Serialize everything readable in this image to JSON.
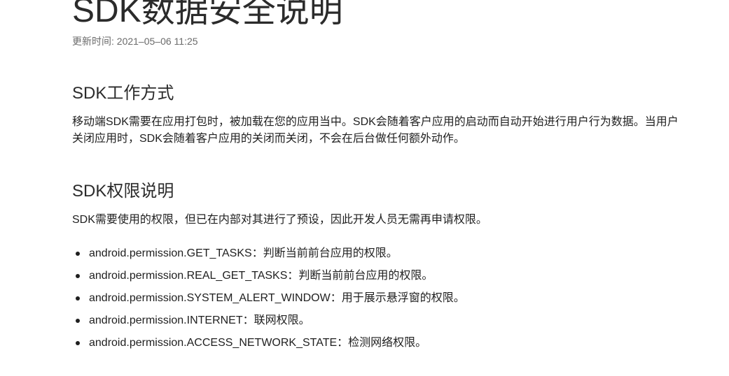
{
  "page": {
    "title": "SDK数据安全说明",
    "update_time": "更新时间: 2021–05–06 11:25"
  },
  "sections": [
    {
      "heading": "SDK工作方式",
      "paragraph": "移动端SDK需要在应用打包时，被加载在您的应用当中。SDK会随着客户应用的启动而自动开始进行用户行为数据。当用户关闭应用时，SDK会随着客户应用的关闭而关闭，不会在后台做任何额外动作。"
    },
    {
      "heading": "SDK权限说明",
      "paragraph": "SDK需要使用的权限，但已在内部对其进行了预设，因此开发人员无需再申请权限。",
      "permissions": [
        "android.permission.GET_TASKS：判断当前前台应用的权限。",
        "android.permission.REAL_GET_TASKS：判断当前前台应用的权限。",
        "android.permission.SYSTEM_ALERT_WINDOW：用于展示悬浮窗的权限。",
        "android.permission.INTERNET：联网权限。",
        "android.permission.ACCESS_NETWORK_STATE：检测网络权限。"
      ]
    }
  ]
}
